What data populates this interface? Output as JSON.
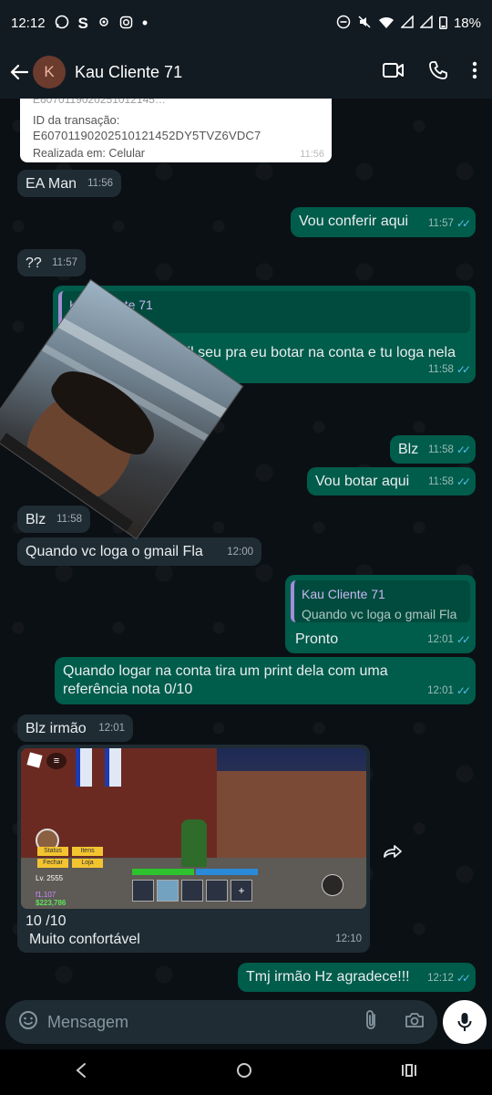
{
  "status_bar": {
    "time": "12:12",
    "battery": "18%"
  },
  "header": {
    "avatar_letter": "K",
    "contact_name": "Kau Cliente 71"
  },
  "messages": {
    "receipt_partial": "E6070119020251012145…",
    "receipt_label": "ID da transação:",
    "receipt_id": "E60701190202510121452DY5TVZ6VDC7",
    "receipt_realized": "Realizada em:  Celular",
    "receipt_time": "11:56",
    "m1_text": "EA Man",
    "m1_time": "11:56",
    "m2_text": "Vou conferir aqui",
    "m2_time": "11:57",
    "m3_text": "??",
    "m3_time": "11:57",
    "m4_quote_name": "Kau Cliente 71",
    "m4_text": "il seu pra eu botar na conta e tu loga nela",
    "m4_time": "11:58",
    "m5_text": "Blz",
    "m5_time": "11:58",
    "m6_text": "Vou botar aqui",
    "m6_time": "11:58",
    "m7_text": "Blz",
    "m7_time": "11:58",
    "m8_text": "Quando vc loga o gmail Fla",
    "m8_time": "12:00",
    "m9_quote_name": "Kau Cliente 71",
    "m9_quote_text": "Quando vc loga o gmail Fla",
    "m9_text": "Pronto",
    "m9_time": "12:01",
    "m10_text_line1": "Quando logar na conta tira um print dela com uma",
    "m10_text_line2": "referência nota 0/10",
    "m10_time": "12:01",
    "m11_text": "Blz irmão",
    "m11_time": "12:01",
    "m12_caption_line1": "10 /10",
    "m12_caption_line2": "Muito confortável",
    "m12_time": "12:10",
    "m13_text": "Tmj irmão Hz agradece!!!",
    "m13_time": "12:12"
  },
  "game_screenshot": {
    "level": "Lv. 2555",
    "money": "$223,786",
    "fragments": "f1,107",
    "btn_status": "Status",
    "btn_items": "Itens",
    "btn_fechar": "Fechar",
    "btn_loja": "Loja"
  },
  "input": {
    "placeholder": "Mensagem"
  },
  "colors": {
    "incoming_bubble": "#1f2c34",
    "outgoing_bubble": "#005c4b",
    "read_ticks": "#53bdeb",
    "background": "#0b1014"
  }
}
